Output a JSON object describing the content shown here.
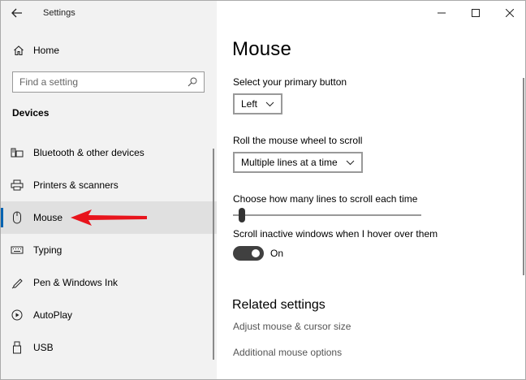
{
  "window": {
    "title": "Settings"
  },
  "sidebar": {
    "home_label": "Home",
    "search_placeholder": "Find a setting",
    "section_title": "Devices",
    "items": [
      {
        "label": "Bluetooth & other devices",
        "icon": "bluetooth-devices-icon"
      },
      {
        "label": "Printers & scanners",
        "icon": "printer-icon"
      },
      {
        "label": "Mouse",
        "icon": "mouse-icon",
        "selected": true
      },
      {
        "label": "Typing",
        "icon": "keyboard-icon"
      },
      {
        "label": "Pen & Windows Ink",
        "icon": "pen-icon"
      },
      {
        "label": "AutoPlay",
        "icon": "autoplay-icon"
      },
      {
        "label": "USB",
        "icon": "usb-icon"
      }
    ]
  },
  "main": {
    "title": "Mouse",
    "primary_button": {
      "label": "Select your primary button",
      "value": "Left"
    },
    "scroll_wheel": {
      "label": "Roll the mouse wheel to scroll",
      "value": "Multiple lines at a time"
    },
    "lines_to_scroll": {
      "label": "Choose how many lines to scroll each time",
      "fraction": 0.03
    },
    "inactive_scroll": {
      "label": "Scroll inactive windows when I hover over them",
      "state": "On",
      "on": true
    },
    "related": {
      "title": "Related settings",
      "links": [
        "Adjust mouse & cursor size",
        "Additional mouse options"
      ]
    }
  },
  "colors": {
    "annotation_arrow": "#e8141c",
    "selected_bg": "#e0e0e0",
    "toggle_on": "#404040"
  }
}
